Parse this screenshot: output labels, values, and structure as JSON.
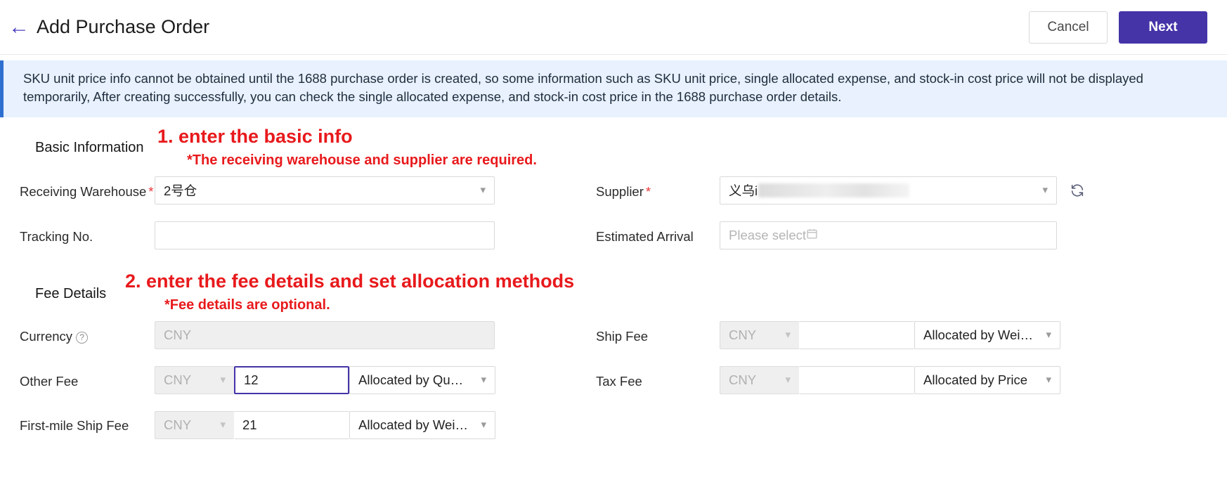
{
  "header": {
    "back_icon": "left-arrow-icon",
    "title": "Add Purchase Order",
    "cancel_label": "Cancel",
    "next_label": "Next",
    "accent_color": "#4434a8"
  },
  "notice": {
    "text": "SKU unit price info cannot be obtained until the 1688 purchase order is created, so some information such as SKU unit price, single allocated expense, and stock-in cost price will not be displayed temporarily, After creating successfully, you can check the single allocated expense, and stock-in cost price in the 1688 purchase order details.",
    "background": "#e8f1fd",
    "border_color": "#2f6fd0"
  },
  "annotations": {
    "color": "#e8191c",
    "step1_title": "1. enter the basic info",
    "step1_note": "*The receiving warehouse and supplier are required.",
    "step2_title": "2. enter the fee details and set allocation methods",
    "step2_note": "*Fee details are optional."
  },
  "basic_information": {
    "section_title": "Basic Information",
    "receiving_warehouse": {
      "label": "Receiving Warehouse",
      "required_mark": "*",
      "value": "2号仓",
      "caret_icon": "chevron-down-icon"
    },
    "supplier": {
      "label": "Supplier",
      "required_mark": "*",
      "value": "义乌i",
      "value_redacted": true,
      "caret_icon": "chevron-down-icon",
      "refresh_icon": "refresh-icon"
    },
    "tracking_no": {
      "label": "Tracking No.",
      "value": "",
      "placeholder": ""
    },
    "estimated_arrival": {
      "label": "Estimated Arrival",
      "value": "",
      "placeholder": "Please select",
      "calendar_icon": "calendar-icon"
    }
  },
  "fee_details": {
    "section_title": "Fee Details",
    "currency": {
      "label": "Currency",
      "help_icon": "question-circle-icon",
      "value": "CNY",
      "disabled": true
    },
    "rows": [
      {
        "label": "Other Fee",
        "currency": "CNY",
        "amount": "12",
        "amount_focused": true,
        "allocation": "Allocated by Qu…",
        "caret_icon": "chevron-down-icon"
      },
      {
        "label": "First-mile Ship Fee",
        "currency": "CNY",
        "amount": "21",
        "amount_focused": false,
        "allocation": "Allocated by Wei…",
        "caret_icon": "chevron-down-icon"
      }
    ],
    "right_rows": [
      {
        "label": "Ship Fee",
        "currency": "CNY",
        "amount": "",
        "allocation": "Allocated by Wei…",
        "caret_icon": "chevron-down-icon"
      },
      {
        "label": "Tax Fee",
        "currency": "CNY",
        "amount": "",
        "allocation": "Allocated by Price",
        "caret_icon": "chevron-down-icon"
      }
    ]
  }
}
